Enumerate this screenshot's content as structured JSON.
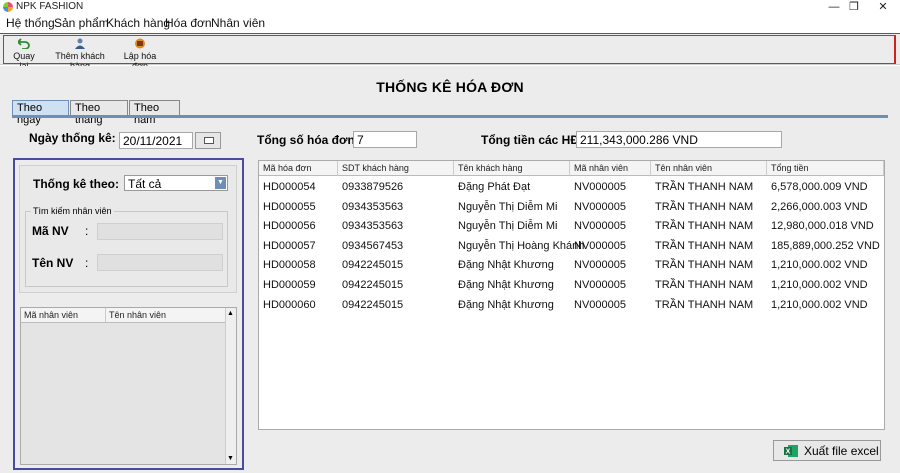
{
  "window": {
    "title": "NPK FASHION",
    "minimize": "—",
    "maximize": "❐",
    "close": "✕"
  },
  "menu": [
    "Hệ thống",
    "Sản phẩm",
    "Khách hàng",
    "Hóa đơn",
    "Nhân viên"
  ],
  "toolbar": {
    "back_label": "Quay lại",
    "add_customer_label": "Thêm khách hàng",
    "create_invoice_label": "Lập hóa đơn"
  },
  "page": {
    "title": "THỐNG KÊ HÓA ĐƠN",
    "tabs": [
      "Theo ngày",
      "Theo tháng",
      "Theo năm"
    ],
    "active_tab": "Theo ngày"
  },
  "stats": {
    "date_label": "Ngày thống kê:",
    "date_value": "20/11/2021",
    "total_invoices_label": "Tổng số hóa đơn:",
    "total_invoices_value": "7",
    "total_amount_label": "Tổng tiền các HĐ:",
    "total_amount_value": "211,343,000.286 VND"
  },
  "filter": {
    "label": "Thống kê theo:",
    "selected": "Tất cả",
    "search_group": "Tìm kiếm nhân viên",
    "emp_id_label": "Mã NV",
    "emp_name_label": "Tên NV",
    "colon": ":"
  },
  "employee_table": {
    "headers": [
      "Mã nhân viên",
      "Tên nhân viên"
    ]
  },
  "invoice_table": {
    "headers": [
      "Mã hóa đơn",
      "SDT khách hàng",
      "Tên khách hàng",
      "Mã nhân viên",
      "Tên nhân viên",
      "Tổng tiền"
    ],
    "rows": [
      [
        "HD000054",
        "0933879526",
        "Đặng Phát Đạt",
        "NV000005",
        "TRẦN THANH NAM",
        "6,578,000.009 VND"
      ],
      [
        "HD000055",
        "0934353563",
        "Nguyễn Thị Diễm Mi",
        "NV000005",
        "TRẦN THANH NAM",
        "2,266,000.003 VND"
      ],
      [
        "HD000056",
        "0934353563",
        "Nguyễn Thị Diễm Mi",
        "NV000005",
        "TRẦN THANH NAM",
        "12,980,000.018 VND"
      ],
      [
        "HD000057",
        "0934567453",
        "Nguyễn Thị Hoàng Khánh",
        "NV000005",
        "TRẦN THANH NAM",
        "185,889,000.252 VND"
      ],
      [
        "HD000058",
        "0942245015",
        "Đặng Nhật Khương",
        "NV000005",
        "TRẦN THANH NAM",
        "1,210,000.002 VND"
      ],
      [
        "HD000059",
        "0942245015",
        "Đặng Nhật Khương",
        "NV000005",
        "TRẦN THANH NAM",
        "1,210,000.002 VND"
      ],
      [
        "HD000060",
        "0942245015",
        "Đặng Nhật Khương",
        "NV000005",
        "TRẦN THANH NAM",
        "1,210,000.002 VND"
      ]
    ]
  },
  "export": {
    "label": "Xuất file excel"
  },
  "colors": {
    "accent_border": "#4a4a9e",
    "toolbar_border": "#bb3333",
    "excel_green": "#1d7044"
  }
}
